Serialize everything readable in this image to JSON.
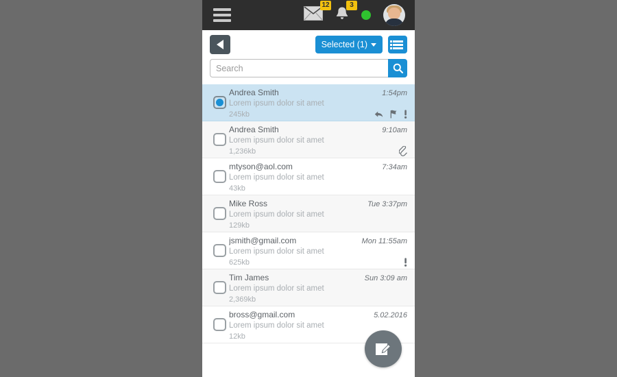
{
  "topbar": {
    "menu_icon": "hamburger-menu-icon",
    "mail_icon": "envelope-icon",
    "mail_badge": "12",
    "notifications_icon": "bell-icon",
    "notifications_badge": "3",
    "status_icon": "online-status-dot",
    "avatar_icon": "user-avatar"
  },
  "actionbar": {
    "back_icon": "back-arrow-icon",
    "selected_label": "Selected (1)",
    "dropdown_icon": "chevron-down-icon",
    "listview_icon": "list-view-icon"
  },
  "search": {
    "placeholder": "Search",
    "value": "",
    "button_icon": "search-icon"
  },
  "list": {
    "rows": [
      {
        "sender": "Andrea Smith",
        "snippet": "Lorem ipsum dolor sit amet",
        "time": "1:54pm",
        "size": "245kb",
        "selected": true,
        "icons": [
          "reply-icon",
          "flag-icon",
          "priority-icon"
        ]
      },
      {
        "sender": "Andrea Smith",
        "snippet": "Lorem ipsum dolor sit amet",
        "time": "9:10am",
        "size": "1,236kb",
        "selected": false,
        "icons": [
          "attachment-icon"
        ]
      },
      {
        "sender": "mtyson@aol.com",
        "snippet": "Lorem ipsum dolor sit amet",
        "time": "7:34am",
        "size": "43kb",
        "selected": false,
        "icons": []
      },
      {
        "sender": "Mike Ross",
        "snippet": "Lorem ipsum dolor sit amet",
        "time": "Tue 3:37pm",
        "size": "129kb",
        "selected": false,
        "icons": []
      },
      {
        "sender": "jsmith@gmail.com",
        "snippet": "Lorem ipsum dolor sit amet",
        "time": "Mon 11:55am",
        "size": "625kb",
        "selected": false,
        "icons": [
          "priority-icon"
        ]
      },
      {
        "sender": "Tim James",
        "snippet": "Lorem ipsum dolor sit amet",
        "time": "Sun 3:09 am",
        "size": "2,369kb",
        "selected": false,
        "icons": []
      },
      {
        "sender": "bross@gmail.com",
        "snippet": "Lorem ipsum dolor sit amet",
        "time": "5.02.2016",
        "size": "12kb",
        "selected": false,
        "icons": []
      }
    ]
  },
  "fab": {
    "icon": "compose-icon"
  },
  "colors": {
    "accent_blue": "#1a8fd4",
    "badge_yellow": "#f2c10f",
    "status_green": "#2fc32f",
    "topbar_dark": "#2e2e2e",
    "selected_row": "#cbe3f2",
    "fab_gray": "#6d767c"
  }
}
